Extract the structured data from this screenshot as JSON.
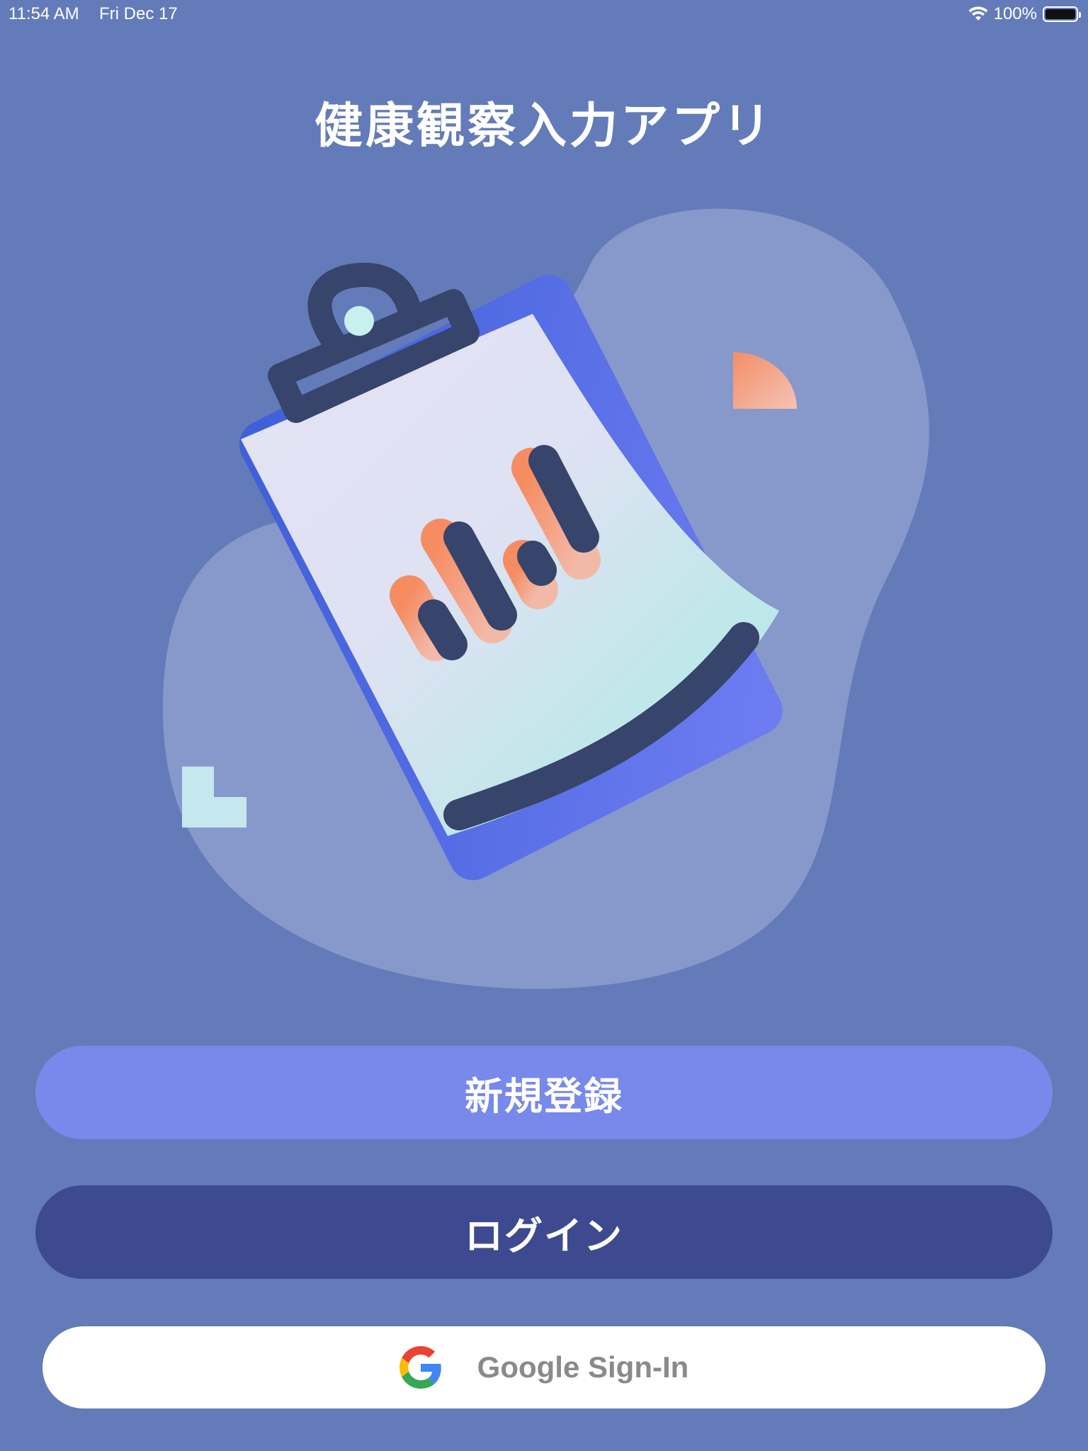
{
  "status_bar": {
    "time": "11:54 AM",
    "date": "Fri Dec 17",
    "battery": "100%",
    "icons": [
      "wifi-icon",
      "battery-icon"
    ]
  },
  "app": {
    "title": "健康観察入力アプリ"
  },
  "illustration": {
    "icon": "clipboard-chart-illustration"
  },
  "buttons": {
    "register_label": "新規登録",
    "login_label": "ログイン",
    "google_label": "Google Sign-In",
    "google_icon": "google-logo-icon"
  },
  "colors": {
    "background": "#637bb8",
    "register": "#7789ea",
    "login": "#3e4a8f",
    "google_bg": "#ffffff",
    "google_text": "#8a8a8a"
  }
}
